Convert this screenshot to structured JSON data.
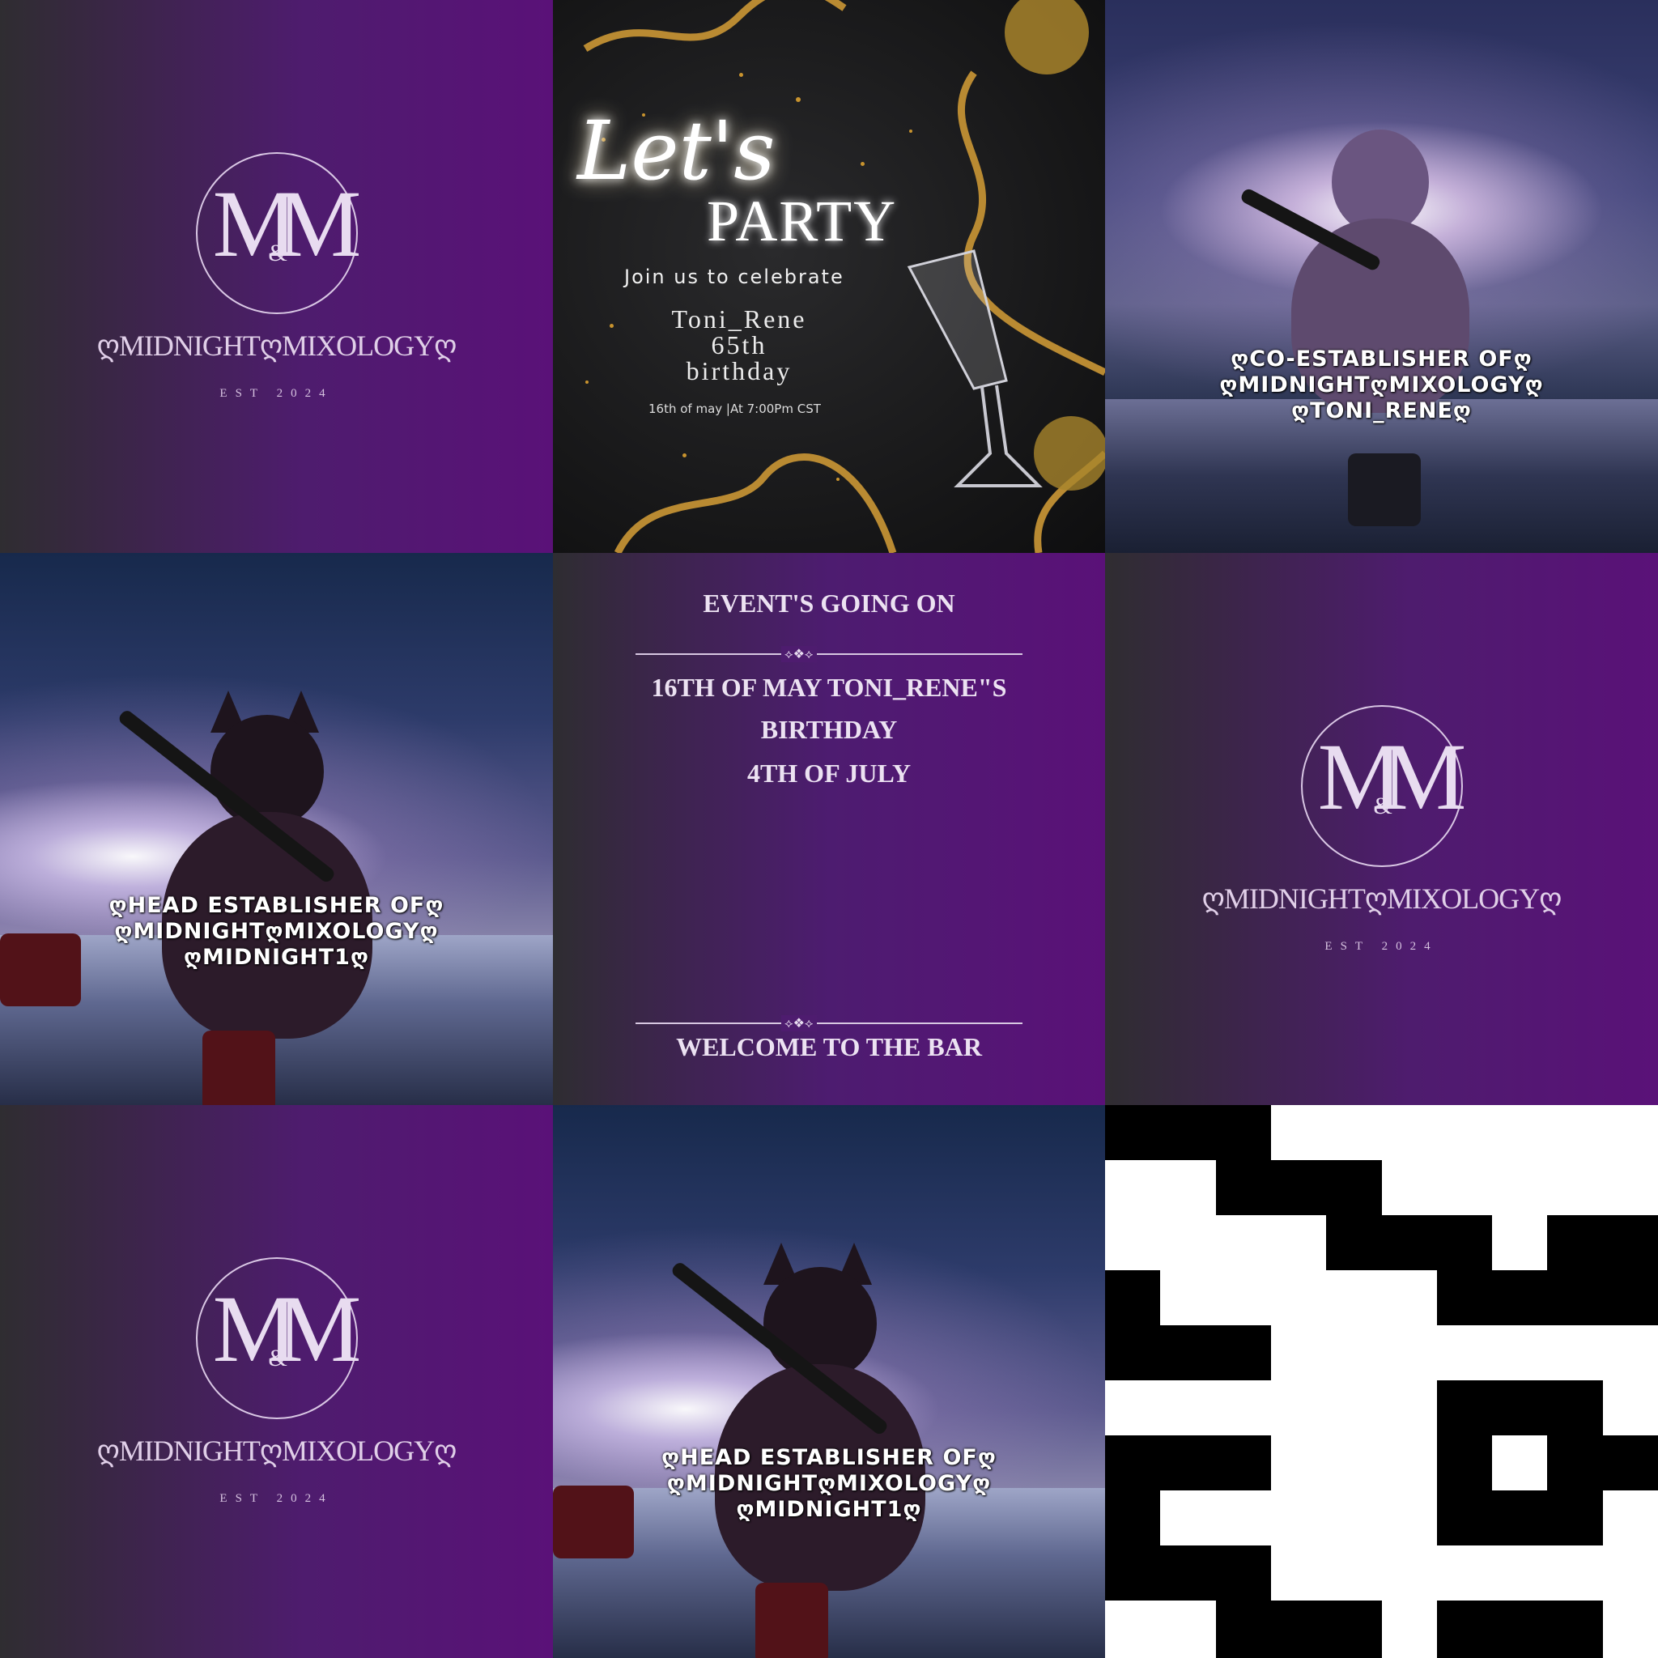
{
  "brand": {
    "name": "ღMIDNIGHTღMIXOLOGYღ",
    "monogram": "MM",
    "ampersand": "&",
    "est": "EST 2024"
  },
  "party": {
    "lets": "Let's",
    "party": "PARTY",
    "join": "Join us to celebrate",
    "honoree_line1": "Toni_Rene",
    "honoree_line2": "65th",
    "honoree_line3": "birthday",
    "when": "16th of may |At 7:00Pm CST"
  },
  "co_establisher": {
    "line1": "ღCO-ESTABLISHER OFღ",
    "line2": "ღMIDNIGHTღMIXOLOGYღ",
    "line3": "ღTONI_RENEღ"
  },
  "head_establisher": {
    "line1": "ღHEAD ESTABLISHER OFღ",
    "line2": "ღMIDNIGHTღMIXOLOGYღ",
    "line3": "ღMIDNIGHT1ღ"
  },
  "events": {
    "title": "EVENT'S GOING ON",
    "line1": "16TH OF MAY TONI_RENE\"S",
    "line2": "BIRTHDAY",
    "line3": "4TH OF JULY",
    "footer": "WELCOME TO THE BAR",
    "ornament": "⟡❖⟡"
  },
  "colors": {
    "purple_dark": "#2f2d31",
    "purple_brand": "#5a1178",
    "gold": "#b98a32",
    "party_bg": "#161617"
  }
}
